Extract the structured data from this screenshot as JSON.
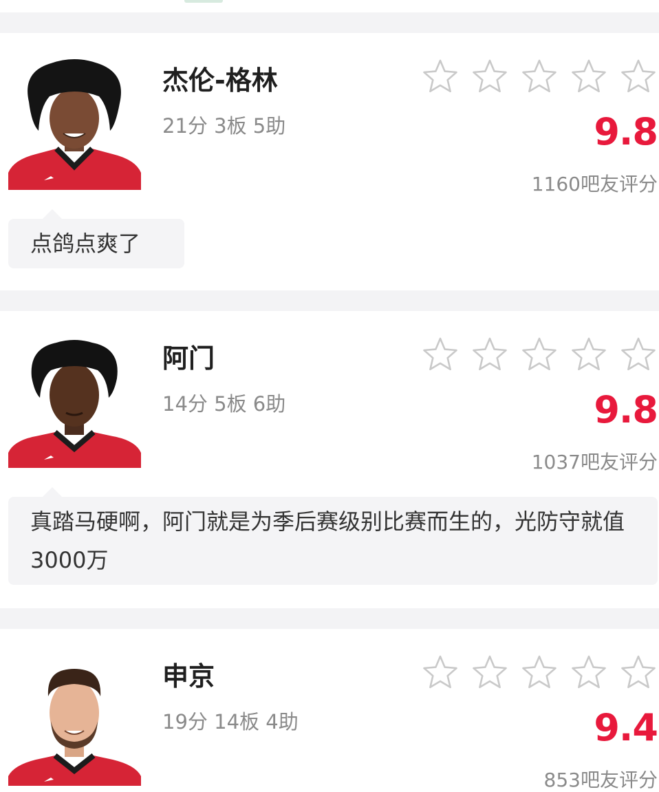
{
  "colors": {
    "score": "#e8193c",
    "jersey": "#d62436",
    "star_outline": "#c9c9c9"
  },
  "rating_scale": 5,
  "players": [
    {
      "name": "杰伦-格林",
      "stats": "21分 3板 5助",
      "score": "9.8",
      "raters": "1160吧友评分",
      "comment": "点鸽点爽了",
      "stars_filled": 0
    },
    {
      "name": "阿门",
      "stats": "14分 5板 6助",
      "score": "9.8",
      "raters": "1037吧友评分",
      "comment": "真踏马硬啊，阿门就是为季后赛级别比赛而生的，光防守就值3000万",
      "stars_filled": 0
    },
    {
      "name": "申京",
      "stats": "19分 14板 4助",
      "score": "9.4",
      "raters": "853吧友评分",
      "stars_filled": 0
    }
  ]
}
